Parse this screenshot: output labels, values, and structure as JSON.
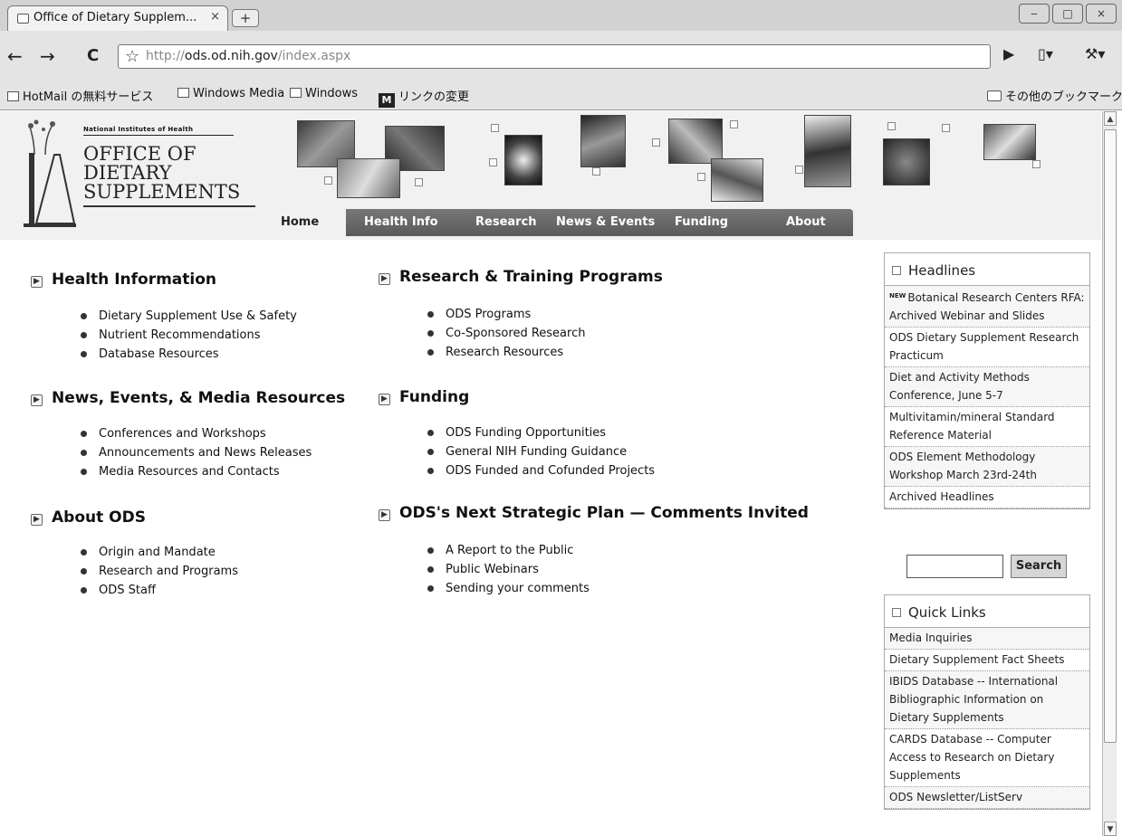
{
  "browser": {
    "tab_title": "Office of Dietary Supplem...",
    "tab_close": "×",
    "new_tab": "+",
    "window_controls": [
      "‒",
      "□",
      "×"
    ],
    "back": "←",
    "forward": "→",
    "reload": "C",
    "url_scheme": "http://",
    "url_host": "ods.od.nih.gov",
    "url_path": "/index.aspx",
    "page_menu": "▶",
    "doc_menu": "▾",
    "tools_menu": "▾",
    "bookmarks": [
      "HotMail の無料サービス",
      "Windows Media",
      "Windows",
      "リンクの変更"
    ],
    "other_bookmarks": "その他のブックマーク"
  },
  "header": {
    "nih_line": "National Institutes of Health",
    "logo_lines": [
      "OFFICE OF",
      "DIETARY",
      "SUPPLEMENTS"
    ],
    "menu": [
      "Home",
      "Health Info",
      "Research",
      "News & Events",
      "Funding",
      "About"
    ]
  },
  "main": {
    "sections": [
      {
        "title": "Health Information",
        "items": [
          "Dietary Supplement Use & Safety",
          "Nutrient Recommendations",
          "Database Resources"
        ]
      },
      {
        "title": "Research & Training Programs",
        "items": [
          "ODS Programs",
          "Co-Sponsored Research",
          "Research Resources"
        ]
      },
      {
        "title": "News, Events, & Media Resources",
        "items": [
          "Conferences and Workshops",
          "Announcements and News Releases",
          "Media Resources and Contacts"
        ]
      },
      {
        "title": "Funding",
        "items": [
          "ODS Funding Opportunities",
          "General NIH Funding Guidance",
          "ODS Funded and Cofunded Projects"
        ]
      },
      {
        "title": "About ODS",
        "items": [
          "Origin and Mandate",
          "Research and Programs",
          "ODS Staff"
        ]
      },
      {
        "title": "ODS's Next Strategic Plan — Comments Invited",
        "items": [
          "A Report to the Public",
          "Public Webinars",
          "Sending your comments"
        ]
      }
    ]
  },
  "sidebar": {
    "headlines_title": "Headlines",
    "new_tag": "NEW",
    "headlines": [
      "Botanical Research Centers RFA: Archived Webinar and Slides",
      "ODS Dietary Supplement Research Practicum",
      "Diet and Activity Methods Conference, June 5-7",
      "Multivitamin/mineral Standard Reference Material",
      "ODS Element Methodology Workshop March 23rd-24th",
      "Archived Headlines"
    ],
    "search_value": "",
    "search_button": "Search",
    "quicklinks_title": "Quick Links",
    "quicklinks": [
      "Media Inquiries",
      "Dietary Supplement Fact Sheets",
      "IBIDS Database -- International Bibliographic Information on Dietary Supplements",
      "CARDS Database -- Computer Access to Research on Dietary Supplements",
      "ODS Newsletter/ListServ"
    ]
  },
  "scrollbar": {
    "up": "▲",
    "down": "▼"
  }
}
